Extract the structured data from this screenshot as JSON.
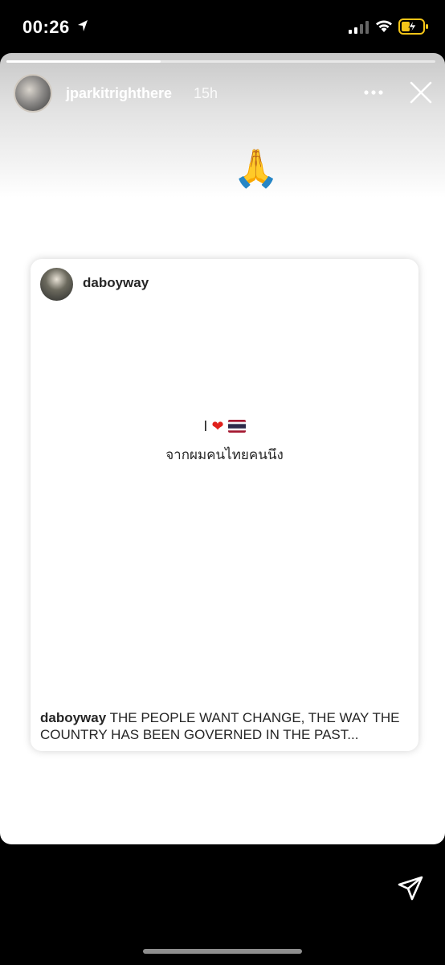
{
  "status_bar": {
    "time": "00:26"
  },
  "story": {
    "progress": 0.36,
    "username": "jparkitrighthere",
    "time_ago": "15h",
    "emoji": "🙏"
  },
  "post": {
    "username": "daboyway",
    "line1_prefix": "I",
    "line2": "จากผมคนไทยคนนึง",
    "caption_user": "daboyway",
    "caption_text": " THE PEOPLE WANT CHANGE,  THE WAY THE COUNTRY HAS BEEN GOVERNED  IN THE PAST..."
  },
  "icons": {
    "location": "location-arrow-icon",
    "signal": "cellular-signal-icon",
    "wifi": "wifi-icon",
    "battery": "battery-charging-icon",
    "more": "more-icon",
    "close": "close-icon",
    "send": "send-icon"
  },
  "colors": {
    "heart": "#e0201b",
    "battery": "#f5c518"
  }
}
